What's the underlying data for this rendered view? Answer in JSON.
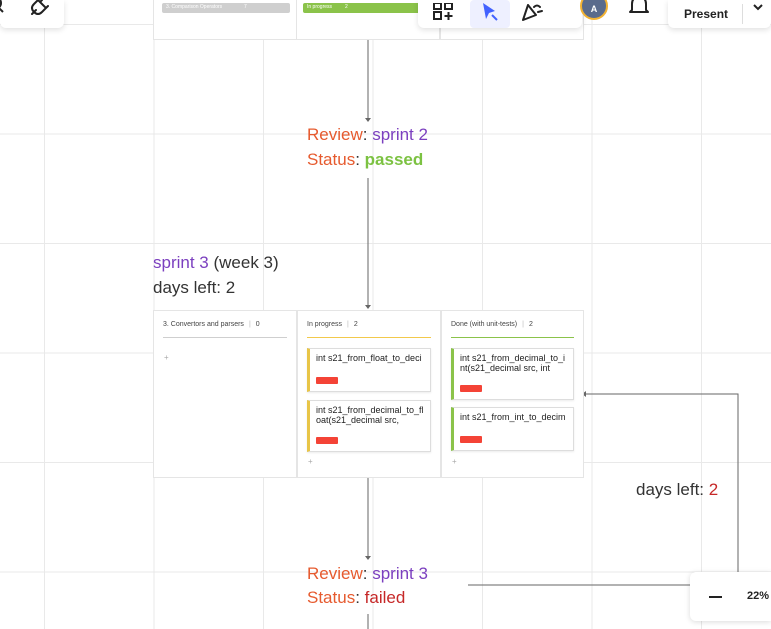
{
  "toolbar": {
    "present_label": "Present",
    "avatar_initial": "A"
  },
  "top_board": {
    "col1_header": "3. Comparison Operators",
    "col1_count": "7",
    "col2_header": "In progress",
    "col2_count": "2"
  },
  "review1": {
    "review_label": "Review",
    "review_value": "sprint 2",
    "status_label": "Status",
    "status_value": "passed"
  },
  "sprint3": {
    "sprint_label": "sprint 3",
    "week_label": "(week 3)",
    "days_left_label": "days left:",
    "days_left_value": "2"
  },
  "board": {
    "columns": [
      {
        "header": "3. Convertors and parsers",
        "count": "0",
        "cards": []
      },
      {
        "header": "In progress",
        "count": "2",
        "cards": [
          {
            "text": "int s21_from_float_to_deci"
          },
          {
            "text": "int s21_from_decimal_to_float(s21_decimal src,"
          }
        ]
      },
      {
        "header": "Done (with unit-tests)",
        "count": "2",
        "cards": [
          {
            "text": "int s21_from_decimal_to_int(s21_decimal src, int"
          },
          {
            "text": "int s21_from_int_to_decim"
          }
        ]
      }
    ],
    "add_symbol": "+"
  },
  "right_note": {
    "days_left_label": "days left:",
    "days_left_value": "2"
  },
  "review2": {
    "review_label": "Review",
    "review_value": "sprint 3",
    "status_label": "Status",
    "status_value": "failed"
  },
  "zoom": {
    "level": "22%",
    "minus": "–"
  },
  "colors": {
    "accent_purple": "#7b3fbf",
    "review_orange": "#e65a2e",
    "passed_green": "#7cc242",
    "failed_red": "#c62828",
    "tag_red": "#f44336",
    "toolbar_active": "#eef0ff"
  },
  "icons": [
    "search-icon",
    "plugin-icon",
    "add-shapes-icon",
    "select-cursor-icon",
    "celebrate-icon",
    "bell-icon",
    "chevron-down-icon",
    "minus-icon"
  ]
}
